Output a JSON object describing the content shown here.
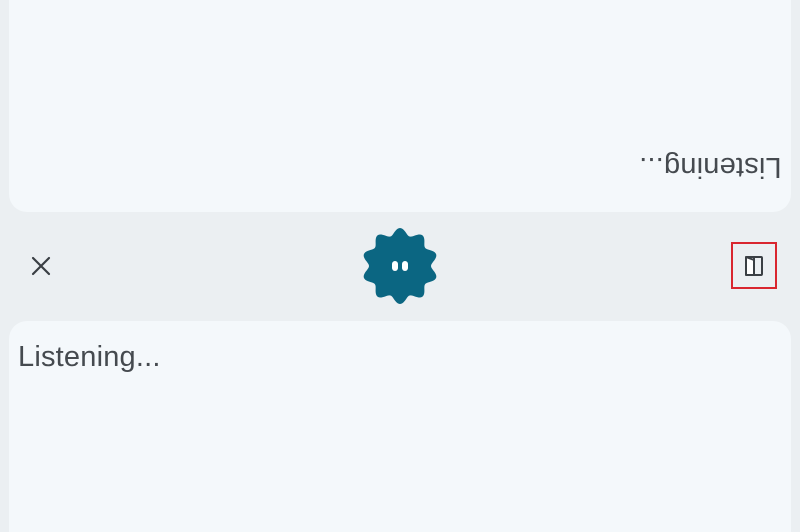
{
  "top_panel": {
    "transcript": "Listening..."
  },
  "bottom_panel": {
    "transcript": "Listening..."
  },
  "controls": {
    "close_icon": "close-icon",
    "mic_icon": "listening-blob-icon",
    "split_icon": "split-view-icon"
  },
  "colors": {
    "accent": "#0b6682",
    "background": "#ebeff2",
    "panel": "#f4f8fb",
    "highlight": "#d9262f"
  }
}
